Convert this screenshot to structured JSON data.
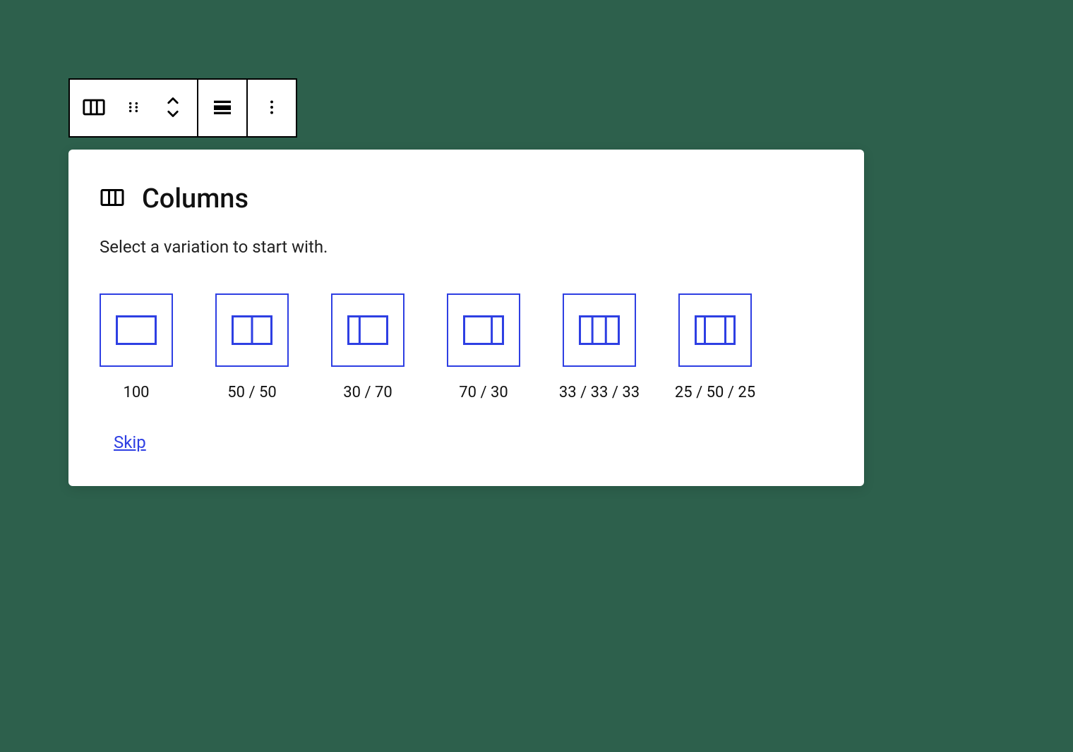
{
  "panel": {
    "title": "Columns",
    "subtitle": "Select a variation to start with.",
    "skip_label": "Skip"
  },
  "variations": [
    {
      "label": "100",
      "cols": [
        100
      ]
    },
    {
      "label": "50 / 50",
      "cols": [
        50,
        50
      ]
    },
    {
      "label": "30 / 70",
      "cols": [
        30,
        70
      ]
    },
    {
      "label": "70 / 30",
      "cols": [
        70,
        30
      ]
    },
    {
      "label": "33 / 33 / 33",
      "cols": [
        33,
        33,
        34
      ]
    },
    {
      "label": "25 / 50 / 25",
      "cols": [
        25,
        50,
        25
      ]
    }
  ],
  "toolbar": {
    "block_icon": "columns",
    "drag_icon": "drag-handle",
    "move_icon": "chevron-up-down",
    "align_icon": "align-wide",
    "more_icon": "more-vertical"
  },
  "colors": {
    "accent": "#2e3fe3",
    "panel_bg": "#ffffff",
    "page_bg": "#2d604c"
  }
}
